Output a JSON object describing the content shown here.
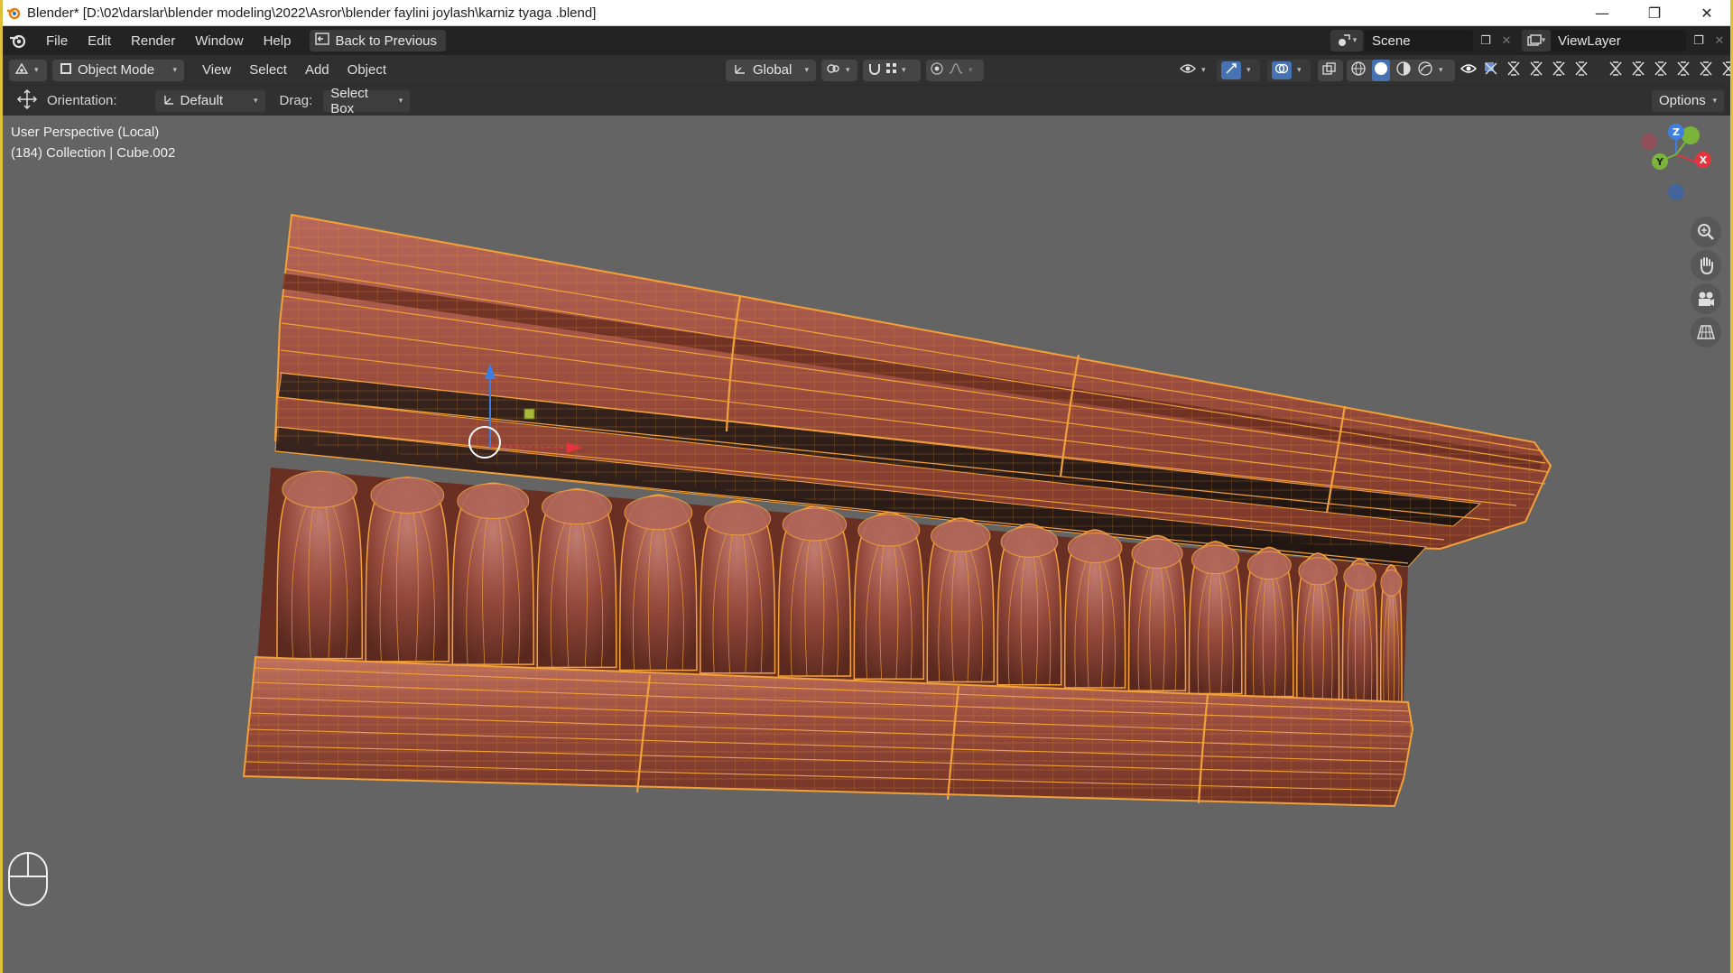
{
  "window": {
    "title": "Blender* [D:\\02\\darslar\\blender modeling\\2022\\Asror\\blender faylini joylash\\karniz tyaga .blend]"
  },
  "topbar": {
    "menus": [
      "File",
      "Edit",
      "Render",
      "Window",
      "Help"
    ],
    "back_label": "Back to Previous",
    "scene_name": "Scene",
    "view_layer": "ViewLayer"
  },
  "header": {
    "mode": "Object Mode",
    "menus": [
      "View",
      "Select",
      "Add",
      "Object"
    ],
    "transform_orientation": "Global"
  },
  "tool_settings": {
    "orientation_label": "Orientation:",
    "orientation_value": "Default",
    "drag_label": "Drag:",
    "drag_value": "Select Box",
    "options_label": "Options"
  },
  "viewport": {
    "view_name": "User Perspective (Local)",
    "object_info": "(184) Collection | Cube.002",
    "gizmo_axes": {
      "x": "X",
      "y": "Y",
      "z": "Z"
    },
    "model": {
      "description_icon": "cornice-mesh",
      "color_base": "#8a4b3a",
      "color_wire": "#f0a030",
      "flutes": 17
    }
  },
  "colors": {
    "accent": "#dec03a",
    "wire": "#f2a13a",
    "axis_x": "#e8343e",
    "axis_y": "#7bb43b",
    "axis_z": "#3d7fe0"
  }
}
